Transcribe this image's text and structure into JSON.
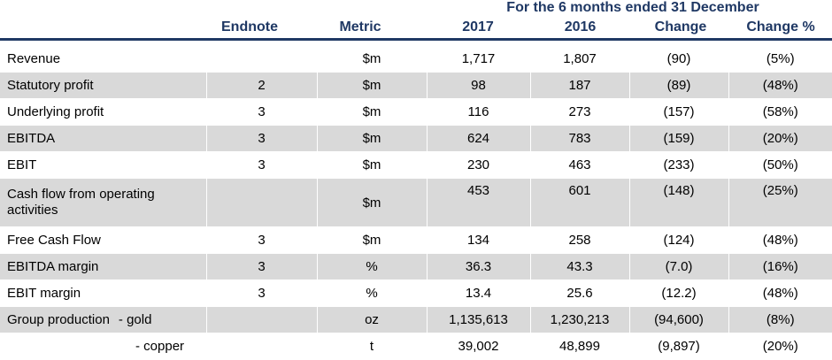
{
  "header": {
    "period": "For the 6 months ended 31 December",
    "columns": [
      "Endnote",
      "Metric",
      "2017",
      "2016",
      "Change",
      "Change %"
    ]
  },
  "rows": [
    {
      "label": "Revenue",
      "sub": "",
      "endnote": "",
      "metric": "$m",
      "y2017": "1,717",
      "y2016": "1,807",
      "change": "(90)",
      "change_pct": "(5%)"
    },
    {
      "label": "Statutory profit",
      "sub": "",
      "endnote": "2",
      "metric": "$m",
      "y2017": "98",
      "y2016": "187",
      "change": "(89)",
      "change_pct": "(48%)"
    },
    {
      "label": "Underlying profit",
      "sub": "",
      "endnote": "3",
      "metric": "$m",
      "y2017": "116",
      "y2016": "273",
      "change": "(157)",
      "change_pct": "(58%)"
    },
    {
      "label": "EBITDA",
      "sub": "",
      "endnote": "3",
      "metric": "$m",
      "y2017": "624",
      "y2016": "783",
      "change": "(159)",
      "change_pct": "(20%)"
    },
    {
      "label": "EBIT",
      "sub": "",
      "endnote": "3",
      "metric": "$m",
      "y2017": "230",
      "y2016": "463",
      "change": "(233)",
      "change_pct": "(50%)"
    },
    {
      "label": "Cash flow from operating activities",
      "sub": "",
      "endnote": "",
      "metric": "$m",
      "y2017": "453",
      "y2016": "601",
      "change": "(148)",
      "change_pct": "(25%)"
    },
    {
      "label": "Free Cash Flow",
      "sub": "",
      "endnote": "3",
      "metric": "$m",
      "y2017": "134",
      "y2016": "258",
      "change": "(124)",
      "change_pct": "(48%)"
    },
    {
      "label": "EBITDA margin",
      "sub": "",
      "endnote": "3",
      "metric": "%",
      "y2017": "36.3",
      "y2016": "43.3",
      "change": "(7.0)",
      "change_pct": "(16%)"
    },
    {
      "label": "EBIT margin",
      "sub": "",
      "endnote": "3",
      "metric": "%",
      "y2017": "13.4",
      "y2016": "25.6",
      "change": "(12.2)",
      "change_pct": "(48%)"
    },
    {
      "label": "Group production",
      "sub": "- gold",
      "endnote": "",
      "metric": "oz",
      "y2017": "1,135,613",
      "y2016": "1,230,213",
      "change": "(94,600)",
      "change_pct": "(8%)"
    },
    {
      "label": "",
      "sub": "- copper",
      "endnote": "",
      "metric": "t",
      "y2017": "39,002",
      "y2016": "48,899",
      "change": "(9,897)",
      "change_pct": "(20%)"
    }
  ]
}
